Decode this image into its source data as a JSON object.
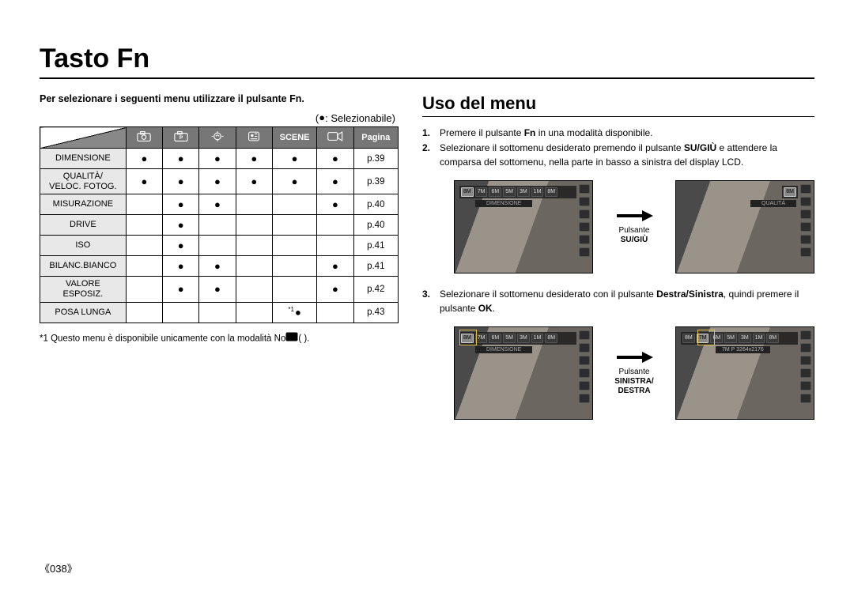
{
  "title": "Tasto Fn",
  "left": {
    "intro": "Per selezionare i seguenti menu utilizzare il pulsante Fn.",
    "legend_symbol": "●",
    "legend_text": ": Selezionabile)",
    "legend_open": "(",
    "headers": {
      "scene": "SCENE",
      "pagina": "Pagina"
    },
    "rows": [
      {
        "label": "DIMENSIONE",
        "c": [
          "●",
          "●",
          "●",
          "●",
          "●",
          "●"
        ],
        "page": "p.39"
      },
      {
        "label": "QUALITÀ/\nVELOC. FOTOG.",
        "c": [
          "●",
          "●",
          "●",
          "●",
          "●",
          "●"
        ],
        "page": "p.39"
      },
      {
        "label": "MISURAZIONE",
        "c": [
          "",
          "●",
          "●",
          "",
          "",
          "●"
        ],
        "page": "p.40"
      },
      {
        "label": "DRIVE",
        "c": [
          "",
          "●",
          "",
          "",
          "",
          ""
        ],
        "page": "p.40"
      },
      {
        "label": "ISO",
        "c": [
          "",
          "●",
          "",
          "",
          "",
          ""
        ],
        "page": "p.41"
      },
      {
        "label": "BILANC.BIANCO",
        "c": [
          "",
          "●",
          "●",
          "",
          "",
          "●"
        ],
        "page": "p.41"
      },
      {
        "label": "VALORE\nESPOSIZ.",
        "c": [
          "",
          "●",
          "●",
          "",
          "",
          "●"
        ],
        "page": "p.42"
      },
      {
        "label": "POSA LUNGA",
        "c": [
          "",
          "",
          "",
          "",
          "*1●",
          ""
        ],
        "page": "p.43"
      }
    ],
    "footnote_prefix": "*1 ",
    "footnote": "Questo menu è disponibile unicamente con la modalità Notte (     )."
  },
  "right": {
    "section_title": "Uso del menu",
    "steps1": [
      {
        "n": "1.",
        "html": "Premere il pulsante <b>Fn</b> in una modalità disponibile."
      },
      {
        "n": "2.",
        "html": "Selezionare il sottomenu desiderato premendo il pulsante <b>SU/GIÙ</b> e attendere la comparsa del sottomenu, nella parte in basso a sinistra del display LCD."
      }
    ],
    "fig1": {
      "arrow_label1": "Pulsante",
      "arrow_label2": "SU/GIÙ",
      "lcdA_label": "DIMENSIONE",
      "lcdB_label": "QUALITÀ",
      "chips": [
        "8M",
        "7M",
        "6M",
        "5M",
        "3M",
        "1M",
        "8M"
      ]
    },
    "steps2": [
      {
        "n": "3.",
        "html": "Selezionare il sottomenu desiderato con il pulsante <b>Destra/Sinistra</b>, quindi premere il pulsante <b>OK</b>."
      }
    ],
    "fig2": {
      "arrow_label1": "Pulsante",
      "arrow_label2": "SINISTRA/",
      "arrow_label3": "DESTRA",
      "lcdA_label": "DIMENSIONE",
      "lcdB_detail": "7M P 3264x2176",
      "chips": [
        "8M",
        "7M",
        "6M",
        "5M",
        "3M",
        "1M",
        "8M"
      ]
    }
  },
  "page_number": "《038》"
}
